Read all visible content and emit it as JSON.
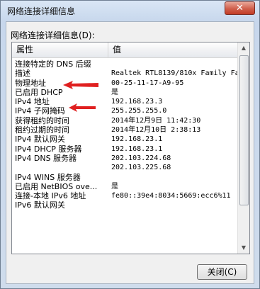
{
  "window": {
    "title": "网络连接详细信息",
    "close_glyph": "✕"
  },
  "group_label": "网络连接详细信息(D):",
  "columns": {
    "property": "属性",
    "value": "值"
  },
  "rows": [
    {
      "property": "连接特定的 DNS 后缀",
      "value": ""
    },
    {
      "property": "描述",
      "value": "Realtek RTL8139/810x Family Fa"
    },
    {
      "property": "物理地址",
      "value": "00-25-11-17-A9-95"
    },
    {
      "property": "已启用 DHCP",
      "value": "是"
    },
    {
      "property": "IPv4 地址",
      "value": "192.168.23.3"
    },
    {
      "property": "IPv4 子网掩码",
      "value": "255.255.255.0"
    },
    {
      "property": "获得租约的时间",
      "value": "2014年12月9日 11:42:30"
    },
    {
      "property": "租约过期的时间",
      "value": "2014年12月10日 2:38:13"
    },
    {
      "property": "IPv4 默认网关",
      "value": "192.168.23.1"
    },
    {
      "property": "IPv4 DHCP 服务器",
      "value": "192.168.23.1"
    },
    {
      "property": "IPv4 DNS 服务器",
      "value": "202.103.224.68"
    },
    {
      "property": "",
      "value": "202.103.225.68"
    },
    {
      "property": "IPv4 WINS 服务器",
      "value": ""
    },
    {
      "property": "已启用 NetBIOS ove...",
      "value": "是"
    },
    {
      "property": "连接-本地 IPv6 地址",
      "value": "fe80::39e4:8034:5669:ecc6%11"
    },
    {
      "property": "IPv6 默认网关",
      "value": ""
    }
  ],
  "buttons": {
    "close": "关闭(C)"
  },
  "colors": {
    "annotation_arrow": "#e02020"
  }
}
